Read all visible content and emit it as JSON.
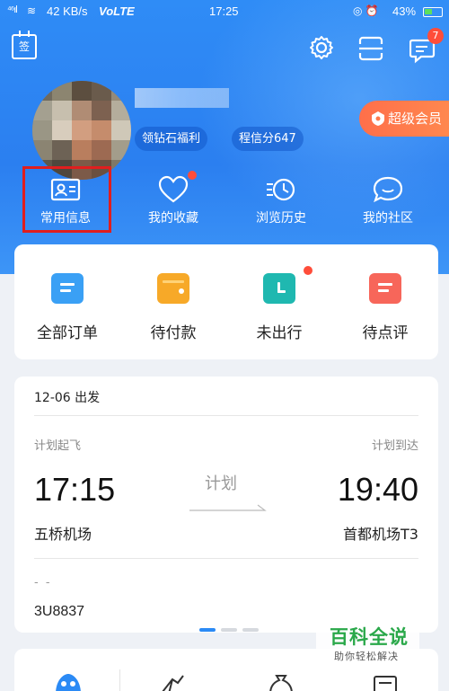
{
  "status_bar": {
    "signal": "⁴⁶ıl",
    "speed": "42 KB/s",
    "network": "VoLTE",
    "time": "17:25",
    "battery": "43%"
  },
  "header": {
    "sign_label": "签",
    "message_badge": "7"
  },
  "profile": {
    "tag_benefit": "领钻石福利",
    "tag_credit": "程信分647",
    "vip_label": "超级会员"
  },
  "quick_links": [
    {
      "label": "常用信息",
      "icon": "id-card-icon"
    },
    {
      "label": "我的收藏",
      "icon": "heart-icon"
    },
    {
      "label": "浏览历史",
      "icon": "history-clock-icon"
    },
    {
      "label": "我的社区",
      "icon": "chat-bubble-icon"
    }
  ],
  "orders": [
    {
      "label": "全部订单",
      "color": "#3aa0f5"
    },
    {
      "label": "待付款",
      "color": "#f7a928"
    },
    {
      "label": "未出行",
      "color": "#1fb8b0"
    },
    {
      "label": "待点评",
      "color": "#f7665a"
    }
  ],
  "trip": {
    "date": "12-06 出发",
    "dep_label": "计划起飞",
    "arr_label": "计划到达",
    "dep_time": "17:15",
    "arr_time": "19:40",
    "status": "计划",
    "dep_airport": "五桥机场",
    "arr_airport": "首都机场T3",
    "placeholder": "- -",
    "flight_no": "3U8837"
  },
  "watermark": {
    "title": "百科全说",
    "subtitle": "助你轻松解决"
  },
  "colors": {
    "brand_blue": "#2b7ff0",
    "badge_red": "#ff4d3a",
    "vip_orange": "#ff7a4c",
    "highlight_red": "#e01e1e"
  }
}
